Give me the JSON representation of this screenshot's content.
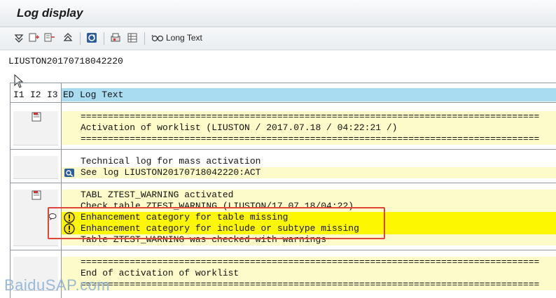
{
  "window": {
    "title": "Log display"
  },
  "toolbar": {
    "buttons": [
      "expand-all-icon",
      "expand-subtree-icon",
      "collapse-icon",
      "collapse-all-icon",
      "refresh-icon",
      "print-icon",
      "layout-icon"
    ],
    "long_text_label": "Long Text"
  },
  "log_name": "LIUSTON20170718042220",
  "columns": {
    "i1": "I1",
    "i2": "I2",
    "i3": "I3",
    "ed": "ED",
    "log_text": "Log Text"
  },
  "groups": [
    {
      "lines": [
        {
          "text": "====================================================================================",
          "style": "y",
          "icon": ""
        },
        {
          "text": "Activation of worklist (LIUSTON / 2017.07.18 / 04:22:21 /)",
          "style": "y",
          "icon": ""
        },
        {
          "text": "====================================================================================",
          "style": "y",
          "icon": ""
        }
      ]
    },
    {
      "lines": [
        {
          "text": "Technical log for mass activation",
          "style": "w",
          "icon": ""
        },
        {
          "text": "See log LIUSTON20170718042220:ACT",
          "style": "y",
          "icon": "log-link-icon"
        }
      ]
    },
    {
      "lines": [
        {
          "text": "TABL ZTEST_WARNING activated",
          "style": "y",
          "icon": ""
        },
        {
          "text": "Check table ZTEST_WARNING (LIUSTON/17.07.18/04:22)",
          "style": "y",
          "icon": ""
        },
        {
          "text": "Enhancement category for table missing",
          "style": "hl",
          "icon": "warning-icon"
        },
        {
          "text": "Enhancement category for include or subtype missing",
          "style": "hl",
          "icon": "warning-icon"
        },
        {
          "text": "Table ZTEST_WARNING was checked with warnings",
          "style": "y",
          "icon": ""
        }
      ]
    },
    {
      "lines": [
        {
          "text": "====================================================================================",
          "style": "y",
          "icon": ""
        },
        {
          "text": "End of activation of worklist",
          "style": "y",
          "icon": ""
        },
        {
          "text": "====================================================================================",
          "style": "y",
          "icon": ""
        }
      ]
    }
  ],
  "watermark": "BaiduSAP.com",
  "colors": {
    "warning_highlight": "#fdf701",
    "line_yellow": "#fdfbc9",
    "header_blue": "#a9dcf0",
    "callout_red": "#e0453a"
  }
}
